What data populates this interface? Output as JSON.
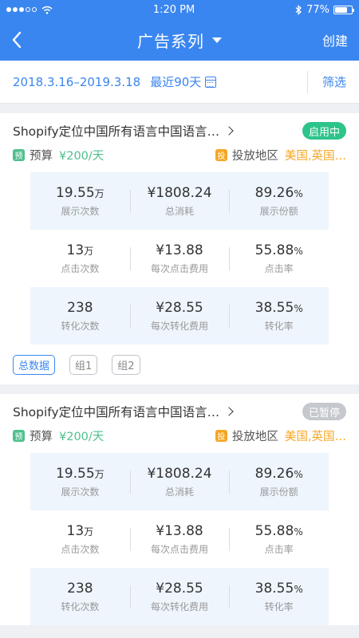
{
  "status_bar": {
    "time": "1:20 PM",
    "battery": "77%",
    "battery_level": 0.77
  },
  "nav": {
    "title": "广告系列",
    "create": "创建"
  },
  "filter": {
    "date_range": "2018.3.16–2019.3.18",
    "recent": "最近90天",
    "filter": "筛选"
  },
  "campaigns": [
    {
      "name": "Shopify定位中国所有语言中国语言…",
      "status": "启用中",
      "budget_label": "预算",
      "budget_tag": "预",
      "budget_value": "¥200/天",
      "geo_label": "投放地区",
      "geo_tag": "投",
      "geo_value": "美国,英国…",
      "metrics": [
        {
          "value": "19.55",
          "unit": "万",
          "label": "展示次数"
        },
        {
          "value": "¥1808.24",
          "unit": "",
          "label": "总消耗"
        },
        {
          "value": "89.26",
          "unit": "%",
          "label": "展示份额"
        },
        {
          "value": "13",
          "unit": "万",
          "label": "点击次数"
        },
        {
          "value": "¥13.88",
          "unit": "",
          "label": "每次点击费用"
        },
        {
          "value": "55.88",
          "unit": "%",
          "label": "点击率"
        },
        {
          "value": "238",
          "unit": "",
          "label": "转化次数"
        },
        {
          "value": "¥28.55",
          "unit": "",
          "label": "每次转化费用"
        },
        {
          "value": "38.55",
          "unit": "%",
          "label": "转化率"
        }
      ],
      "groups": [
        "总数据",
        "组1",
        "组2"
      ]
    },
    {
      "name": "Shopify定位中国所有语言中国语言…",
      "status": "已暂停",
      "budget_label": "预算",
      "budget_tag": "预",
      "budget_value": "¥200/天",
      "geo_label": "投放地区",
      "geo_tag": "投",
      "geo_value": "美国,英国…",
      "metrics": [
        {
          "value": "19.55",
          "unit": "万",
          "label": "展示次数"
        },
        {
          "value": "¥1808.24",
          "unit": "",
          "label": "总消耗"
        },
        {
          "value": "89.26",
          "unit": "%",
          "label": "展示份额"
        },
        {
          "value": "13",
          "unit": "万",
          "label": "点击次数"
        },
        {
          "value": "¥13.88",
          "unit": "",
          "label": "每次点击费用"
        },
        {
          "value": "55.88",
          "unit": "%",
          "label": "点击率"
        },
        {
          "value": "238",
          "unit": "",
          "label": "转化次数"
        },
        {
          "value": "¥28.55",
          "unit": "",
          "label": "每次转化费用"
        },
        {
          "value": "38.55",
          "unit": "%",
          "label": "转化率"
        }
      ]
    }
  ]
}
